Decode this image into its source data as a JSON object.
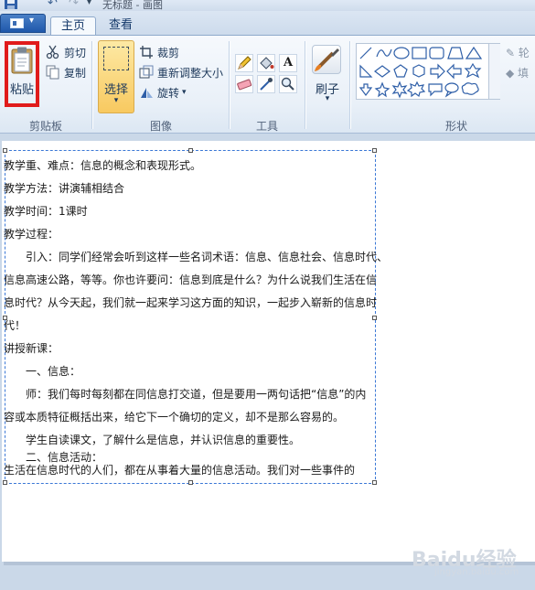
{
  "window": {
    "title": "无标题 - 画图",
    "qat": {
      "undo_glyph": "↶",
      "redo_glyph": "↷",
      "more_glyph": "▾"
    }
  },
  "tabs": [
    {
      "label": "主页",
      "active": true
    },
    {
      "label": "查看",
      "active": false
    }
  ],
  "app_menu": {
    "arrow": "▾"
  },
  "ribbon": {
    "clipboard": {
      "label": "剪贴板",
      "paste": "粘贴",
      "cut": "剪切",
      "copy": "复制",
      "highlight_color": "#e01b1b"
    },
    "image": {
      "label": "图像",
      "select": "选择",
      "select_arrow": "▾",
      "crop": "裁剪",
      "resize": "重新调整大小",
      "rotate": "旋转",
      "rotate_arrow": "▾"
    },
    "tools": {
      "label": "工具",
      "text_glyph": "A"
    },
    "brushes": {
      "label": "刷子",
      "arrow": "▾"
    },
    "shapes": {
      "label": "形状",
      "outline": "轮",
      "fill": "填"
    }
  },
  "canvas": {
    "lines": [
      {
        "text": "教学重、难点：信息的概念和表现形式。",
        "indent": false
      },
      {
        "text": "教学方法：讲演辅相结合",
        "indent": false
      },
      {
        "text": "教学时间：1课时",
        "indent": false
      },
      {
        "text": "教学过程：",
        "indent": false
      },
      {
        "text": "引入：同学们经常会听到这样一些名词术语：信息、信息社会、信息时代、",
        "indent": true
      },
      {
        "text": "信息高速公路，等等。你也许要问：信息到底是什么？为什么说我们生活在信",
        "indent": false
      },
      {
        "text": "息时代？从今天起，我们就一起来学习这方面的知识，一起步入崭新的信息时",
        "indent": false
      },
      {
        "text": "代！",
        "indent": false
      },
      {
        "text": "讲授新课：",
        "indent": false
      },
      {
        "text": "一、信息：",
        "indent": true
      },
      {
        "text": "师：我们每时每刻都在同信息打交道，但是要用一两句话把“信息”的内",
        "indent": true
      },
      {
        "text": "容或本质特征概括出来，给它下一个确切的定义，却不是那么容易的。",
        "indent": false
      },
      {
        "text": "学生自读课文，了解什么是信息，并认识信息的重要性。",
        "indent": true
      },
      {
        "text": "二、信息活动：",
        "indent": true
      },
      {
        "text": "生活在信息时代的人们，都在从事着大量的信息活动。我们对一些事件的",
        "indent": false
      }
    ],
    "watermark": "Baidu经验",
    "watermark_sub": "jingyan.baidu.com"
  },
  "colors": {
    "accent": "#1f58ab",
    "ribbon_bg": "#e9f0f8",
    "select_active": "#f8c960",
    "selection_border": "#3b78d6"
  }
}
